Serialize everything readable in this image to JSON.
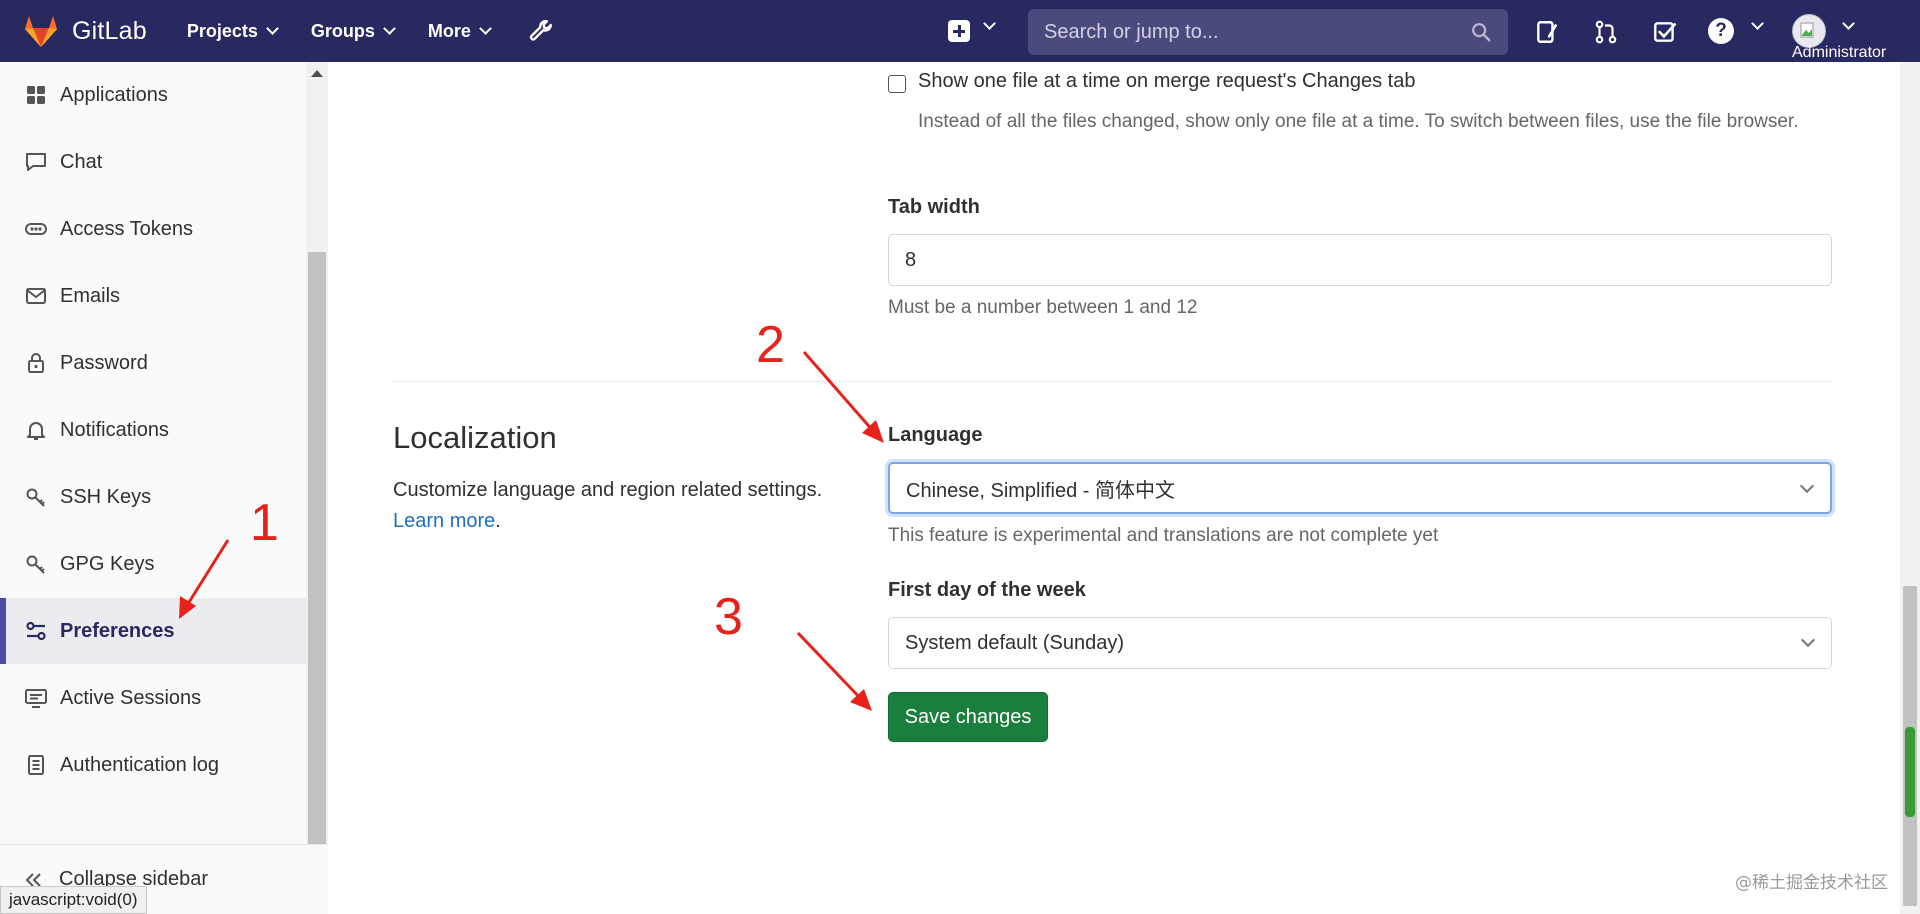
{
  "navbar": {
    "brand": "GitLab",
    "projects": "Projects",
    "groups": "Groups",
    "more": "More",
    "search_placeholder": "Search or jump to...",
    "user": "Administrator"
  },
  "sidebar": {
    "items": [
      {
        "label": "Applications",
        "icon": "applications-icon"
      },
      {
        "label": "Chat",
        "icon": "chat-icon"
      },
      {
        "label": "Access Tokens",
        "icon": "token-icon"
      },
      {
        "label": "Emails",
        "icon": "mail-icon"
      },
      {
        "label": "Password",
        "icon": "lock-icon"
      },
      {
        "label": "Notifications",
        "icon": "bell-icon"
      },
      {
        "label": "SSH Keys",
        "icon": "key-icon"
      },
      {
        "label": "GPG Keys",
        "icon": "key-icon"
      },
      {
        "label": "Preferences",
        "icon": "preferences-icon",
        "active": true
      },
      {
        "label": "Active Sessions",
        "icon": "monitor-icon"
      },
      {
        "label": "Authentication log",
        "icon": "log-icon"
      }
    ],
    "collapse": "Collapse sidebar"
  },
  "status_bar": "javascript:void(0)",
  "main": {
    "single_file_label": "Show one file at a time on merge request's Changes tab",
    "single_file_help": "Instead of all the files changed, show only one file at a time. To switch between files, use the file browser.",
    "tab_width_label": "Tab width",
    "tab_width_value": "8",
    "tab_width_help": "Must be a number between 1 and 12",
    "localization": {
      "title": "Localization",
      "description": "Customize language and region related settings.",
      "learn_more": "Learn more",
      "learn_more_suffix": "."
    },
    "language_label": "Language",
    "language_value": "Chinese, Simplified - 简体中文",
    "language_help": "This feature is experimental and translations are not complete yet",
    "first_day_label": "First day of the week",
    "first_day_value": "System default (Sunday)",
    "save_label": "Save changes"
  },
  "annotations": [
    "1",
    "2",
    "3"
  ],
  "annotation_color": "#e8211b",
  "watermark": "@稀土掘金技术社区"
}
